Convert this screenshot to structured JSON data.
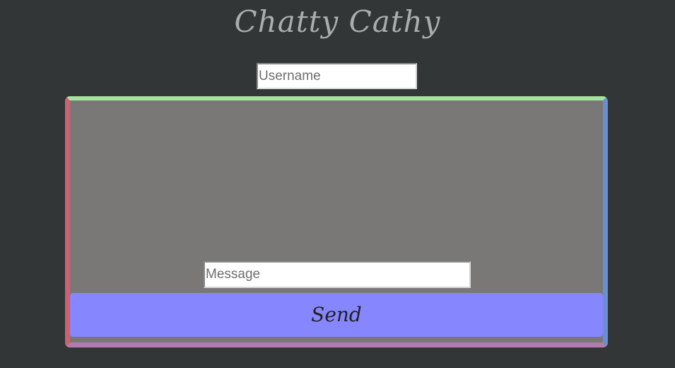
{
  "app": {
    "title": "Chatty Cathy"
  },
  "username_field": {
    "placeholder": "Username",
    "value": ""
  },
  "message_field": {
    "placeholder": "Message",
    "value": ""
  },
  "send_button": {
    "label": "Send"
  },
  "colors": {
    "background": "#323636",
    "title_text": "#a9adad",
    "chat_panel": "#7a7876",
    "border_top": "#a8e2a0",
    "border_left": "#cf5f73",
    "border_right": "#6a8ed2",
    "border_bottom": "#b07cb0",
    "send_button": "#8686fe"
  }
}
